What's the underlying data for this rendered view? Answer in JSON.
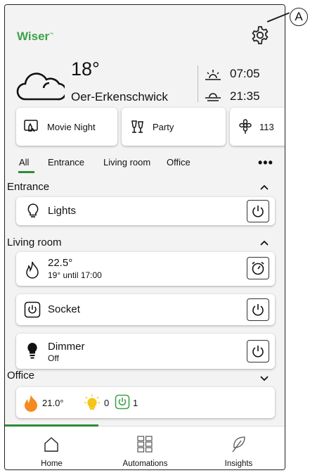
{
  "header": {
    "logo": "Wiser",
    "logo_trademark": "™",
    "temperature": "18°",
    "city": "Oer-Erkenschwick",
    "sunrise": "07:05",
    "sunset": "21:35"
  },
  "scenes": [
    {
      "label": "Movie Night",
      "icon": "movie-night-icon"
    },
    {
      "label": "Party",
      "icon": "party-icon"
    },
    {
      "label": "113",
      "icon": "flower-icon"
    }
  ],
  "tabs": {
    "items": [
      "All",
      "Entrance",
      "Living room",
      "Office"
    ],
    "active": "All",
    "more": "•••"
  },
  "sections": {
    "entrance": {
      "title": "Entrance",
      "devices": [
        {
          "name": "Lights",
          "icon": "bulb-icon"
        }
      ]
    },
    "living_room": {
      "title": "Living room",
      "heating": {
        "value": "22.5°",
        "sub": "19° until 17:00"
      },
      "socket": {
        "name": "Socket"
      },
      "dimmer": {
        "name": "Dimmer",
        "status": "Off"
      }
    },
    "office": {
      "title": "Office",
      "summary": {
        "heat": "21.0°",
        "lights": "0",
        "sockets": "1"
      }
    }
  },
  "nav": [
    {
      "label": "Home",
      "icon": "home-icon"
    },
    {
      "label": "Automations",
      "icon": "grid-icon"
    },
    {
      "label": "Insights",
      "icon": "leaf-icon"
    }
  ],
  "callout": {
    "label": "A"
  },
  "colors": {
    "accent": "#2e8b3a",
    "flame": "#f58a1f",
    "sun": "#f5c518",
    "socket_green": "#3da34a"
  }
}
